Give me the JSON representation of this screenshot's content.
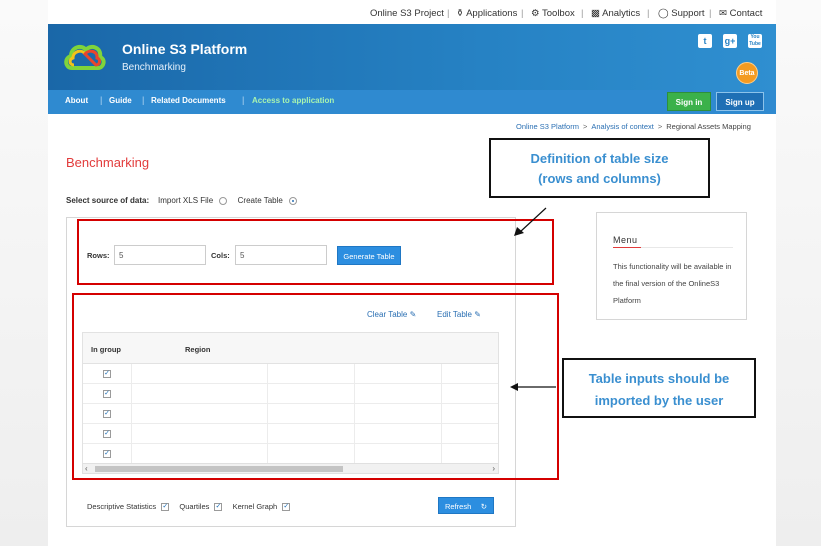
{
  "toplinks": {
    "project": "Online S3 Project",
    "applications": "Applications",
    "toolbox": "Toolbox",
    "analytics": "Analytics",
    "support": "Support",
    "contact": "Contact"
  },
  "header": {
    "title": "Online S3 Platform",
    "subtitle": "Benchmarking",
    "beta": "Beta",
    "social": [
      "t",
      "g+",
      "You Tube"
    ]
  },
  "nav": {
    "items": [
      "About",
      "Guide",
      "Related Documents",
      "Access to application"
    ],
    "signin": "Sign in",
    "signup": "Sign up"
  },
  "breadcrumb": [
    "Online S3 Platform",
    "Analysis of context",
    "Regional Assets Mapping"
  ],
  "page_title": "Benchmarking",
  "source": {
    "label": "Select source of data:",
    "option_import": "Import XLS File",
    "option_create": "Create Table",
    "selected": "Create Table"
  },
  "size_form": {
    "rows_label": "Rows:",
    "rows_value": "5",
    "cols_label": "Cols:",
    "cols_value": "5",
    "generate": "Generate Table"
  },
  "table": {
    "clear": "Clear Table",
    "edit": "Edit Table",
    "headers": [
      "In group",
      "Region"
    ],
    "rows": [
      {
        "in_group": true
      },
      {
        "in_group": true
      },
      {
        "in_group": true
      },
      {
        "in_group": true
      },
      {
        "in_group": true
      }
    ]
  },
  "options": {
    "descriptive": "Descriptive Statistics",
    "quartiles": "Quartiles",
    "kernel": "Kernel Graph",
    "refresh": "Refresh"
  },
  "menu": {
    "title": "Menu",
    "text": "This functionality will be available in the final version of the OnlineS3 Platform"
  },
  "callouts": {
    "size": [
      "Definition of table size",
      "(rows and columns)"
    ],
    "inputs": [
      "Table inputs should be",
      "imported by the user"
    ]
  },
  "colors": {
    "accent_red": "#e23b3b",
    "annotation_red": "#d40000",
    "brand_blue": "#2682c4",
    "callout_blue": "#3a8fd0",
    "signin_green": "#3bb14a"
  }
}
